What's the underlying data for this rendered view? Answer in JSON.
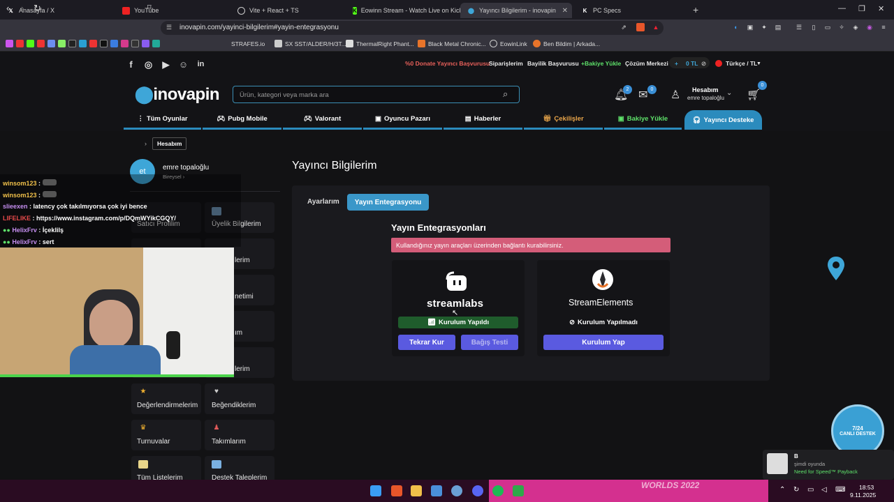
{
  "browser": {
    "tabs": [
      {
        "label": "Anasayfa / X",
        "icon": "X"
      },
      {
        "label": "YouTube",
        "icon": "yt"
      },
      {
        "label": "Vite + React + TS",
        "icon": "globe"
      },
      {
        "label": "Eowinn Stream - Watch Live on Kick",
        "icon": "K"
      },
      {
        "label": "Yayıncı Bilgilerim - inovapin",
        "icon": "pin"
      },
      {
        "label": "PC Specs",
        "icon": "K"
      }
    ],
    "url": "inovapin.com/yayinci-bilgilerim#yayin-entegrasyonu",
    "bookmarks": [
      "STRAFES.io",
      "SX SST/ALDER/H/3T...",
      "ThermalRight Phant...",
      "Black Metal Chronic...",
      "EowinLink",
      "Ben Bildim | Arkada..."
    ]
  },
  "site": {
    "top_links": {
      "donate": "%0 Donate Yayıncı Başvurusu",
      "orders": "Siparişlerim",
      "dealer": "Bayilik Başvurusu",
      "balance": "+Bakiye Yükle",
      "help": "Çözüm Merkezi",
      "wallet": "0 TL",
      "lang": "Türkçe / TL"
    },
    "logo": "inovapin",
    "search_placeholder": "Ürün, kategori veya marka ara",
    "notif_count": "2",
    "mail_count": "0",
    "cart_count": "0",
    "account_title": "Hesabım",
    "account_name": "emre topaloğlu",
    "nav": [
      "Tüm Oyunlar",
      "Pubg Mobile",
      "Valorant",
      "Oyuncu Pazarı",
      "Haberler",
      "Çekilişler",
      "Bakiye Yükle",
      "Yayıncı Desteke"
    ]
  },
  "sidebar": {
    "breadcrumb": "Hesabım",
    "avatar_initials": "et",
    "user_name": "emre topaloğlu",
    "user_type": "Bireysel",
    "items": [
      "Satıcı Profilim",
      "Üyelik Bilgilerim",
      "",
      "lerim",
      "",
      "netimi",
      "",
      "ım",
      "",
      "lerim",
      "Değerlendirmelerim",
      "Beğendiklerim",
      "Turnuvalar",
      "Takımlarım",
      "Tüm Listelerim",
      "Destek Taleplerim"
    ]
  },
  "main": {
    "page_title": "Yayıncı Bilgilerim",
    "tabs": [
      "Ayarlarım",
      "Yayın Entegrasyonu"
    ],
    "section_title": "Yayın Entegrasyonları",
    "alert": "Kullandığınız yayın araçları üzerinden bağlantı kurabilirsiniz.",
    "streamlabs": {
      "name": "streamlabs",
      "status": "Kurulum Yapıldı",
      "btn_reinstall": "Tekrar Kur",
      "btn_test": "Bağış Testi"
    },
    "streamelements": {
      "name": "StreamElements",
      "status": "Kurulum Yapılmadı",
      "btn_install": "Kurulum Yap"
    }
  },
  "overlay": {
    "chat": [
      {
        "user": "winsom123",
        "msg": ""
      },
      {
        "user": "winsom123",
        "msg": ""
      },
      {
        "user": "slieexen",
        "msg": "latency çok takılmıyorsa çok iyi bence"
      },
      {
        "user": "LIFELIKE",
        "msg": "https://www.instagram.com/p/DQmWYikCGQY/"
      },
      {
        "user": "HelixFrv",
        "msg": "İçeklilş"
      },
      {
        "user": "HelixFrv",
        "msg": "sert"
      }
    ],
    "support_line1": "7/24",
    "support_line2": "CANLI DESTEK",
    "toast_title": "B",
    "toast_sub": "şimdi oyunda",
    "toast_game": "Need for Speed™ Payback"
  },
  "taskbar": {
    "time": "18:53",
    "date": "9.11.2025",
    "banner": "WORLDS 2022"
  },
  "colors": {
    "accent": "#3a97c9",
    "alert": "#d45d79",
    "installed": "#1f5c2c",
    "button": "#5a5ae0"
  }
}
